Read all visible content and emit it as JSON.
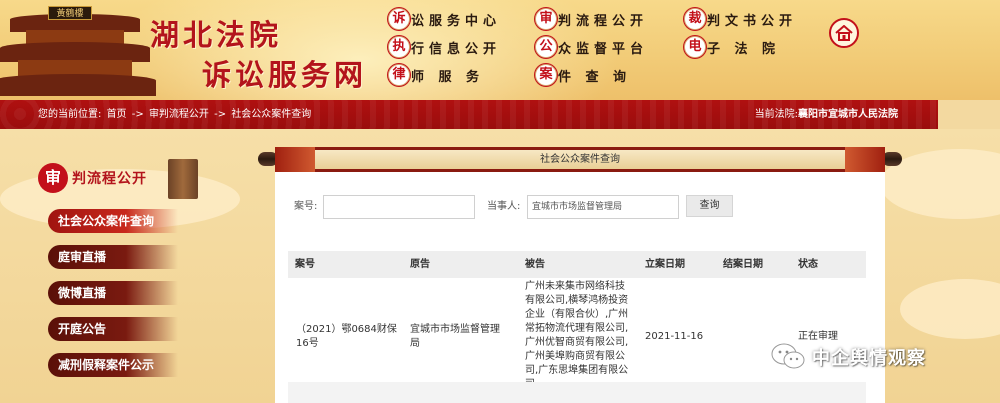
{
  "header": {
    "pagoda_sign": "黃鶴樓",
    "title_line1": "湖北法院",
    "title_line2": "诉讼服务网",
    "nav": [
      {
        "badge": "诉",
        "label": "讼服务中心"
      },
      {
        "badge": "审",
        "label": "判流程公开"
      },
      {
        "badge": "裁",
        "label": "判文书公开"
      },
      {
        "badge": "执",
        "label": "行信息公开"
      },
      {
        "badge": "公",
        "label": "众监督平台"
      },
      {
        "badge": "电",
        "label": "子 法 院"
      },
      {
        "badge": "律",
        "label": "师 服 务"
      },
      {
        "badge": "案",
        "label": "件 查 询"
      }
    ],
    "home_icon": "home-icon"
  },
  "breadcrumb": {
    "prefix": "您的当前位置:",
    "items": [
      "首页",
      "审判流程公开",
      "社会公众案件查询"
    ],
    "separator": "->",
    "court_label": "当前法院:",
    "court_name": "襄阳市宜城市人民法院"
  },
  "sidebar": {
    "seal": "审",
    "title": "判流程公开",
    "items": [
      {
        "label": "社会公众案件查询",
        "active": true
      },
      {
        "label": "庭审直播",
        "active": false
      },
      {
        "label": "微博直播",
        "active": false
      },
      {
        "label": "开庭公告",
        "active": false
      },
      {
        "label": "减刑假释案件公示",
        "active": false
      }
    ]
  },
  "main": {
    "scroll_title": "社会公众案件查询",
    "search": {
      "case_no_label": "案号:",
      "case_no_value": "",
      "party_label": "当事人:",
      "party_value": "宜城市市场监督管理局",
      "query_button": "查询"
    },
    "table": {
      "headers": [
        "案号",
        "原告",
        "被告",
        "立案日期",
        "结案日期",
        "状态"
      ],
      "rows": [
        {
          "case_no": [
            "（2021）鄂0684财保",
            "16号"
          ],
          "plaintiff": [
            "宜城市市场监督管理",
            "局"
          ],
          "defendant": [
            "广州未来集市网络科技",
            "有限公司,横琴鸿杨投资",
            "企业（有限合伙）,广州",
            "常拓物流代理有限公司,",
            "广州优智商贸有限公司,",
            "广州美埠购商贸有限公",
            "司,广东思埠集团有限公",
            "司"
          ],
          "filing_date": "2021-11-16",
          "closing_date": "",
          "status": "正在审理"
        }
      ]
    }
  },
  "watermark": {
    "text": "中企舆情观察",
    "icon": "wechat-icon"
  },
  "colors": {
    "brand_red": "#b3141c",
    "bar_red": "#a00f0f",
    "bg_gold": "#f3d9a0"
  }
}
